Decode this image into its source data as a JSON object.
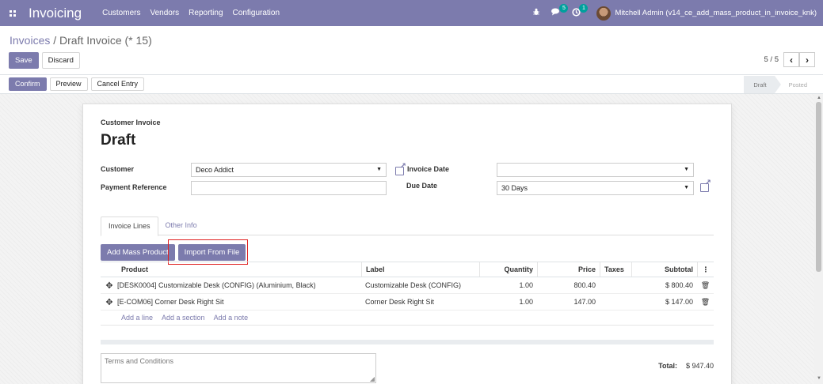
{
  "navbar": {
    "app_name": "Invoicing",
    "menu": [
      "Customers",
      "Vendors",
      "Reporting",
      "Configuration"
    ],
    "messages_count": "5",
    "activities_count": "1",
    "user_name": "Mitchell Admin (v14_ce_add_mass_product_in_invoice_knk)",
    "accent_color": "#7c7bad"
  },
  "control_panel": {
    "breadcrumb_parent": "Invoices",
    "breadcrumb_separator": " / ",
    "breadcrumb_current": "Draft Invoice (* 15)",
    "save_label": "Save",
    "discard_label": "Discard",
    "pager_value": "5 / 5"
  },
  "statusbar": {
    "confirm_label": "Confirm",
    "preview_label": "Preview",
    "cancel_entry_label": "Cancel Entry",
    "stages": [
      "Draft",
      "Posted"
    ],
    "active_stage": "Draft"
  },
  "form": {
    "doc_type": "Customer Invoice",
    "title": "Draft",
    "customer_label": "Customer",
    "customer_value": "Deco Addict",
    "payment_reference_label": "Payment Reference",
    "payment_reference_value": "",
    "invoice_date_label": "Invoice Date",
    "invoice_date_value": "",
    "due_date_label": "Due Date",
    "due_date_value": "30 Days"
  },
  "tabs": [
    "Invoice Lines",
    "Other Info"
  ],
  "buttons": {
    "add_mass_product": "Add Mass Product",
    "import_from_file": "Import From File"
  },
  "table": {
    "columns": [
      "Product",
      "Label",
      "Quantity",
      "Price",
      "Taxes",
      "Subtotal"
    ],
    "rows": [
      {
        "product": "[DESK0004] Customizable Desk (CONFIG) (Aluminium, Black)",
        "label": "Customizable Desk (CONFIG)",
        "quantity": "1.00",
        "price": "800.40",
        "taxes": "",
        "subtotal": "$ 800.40"
      },
      {
        "product": "[E-COM06] Corner Desk Right Sit",
        "label": "Corner Desk Right Sit",
        "quantity": "1.00",
        "price": "147.00",
        "taxes": "",
        "subtotal": "$ 147.00"
      }
    ],
    "add_line": "Add a line",
    "add_section": "Add a section",
    "add_note": "Add a note"
  },
  "footer": {
    "terms_placeholder": "Terms and Conditions",
    "total_label": "Total:",
    "total_value": "$ 947.40"
  }
}
